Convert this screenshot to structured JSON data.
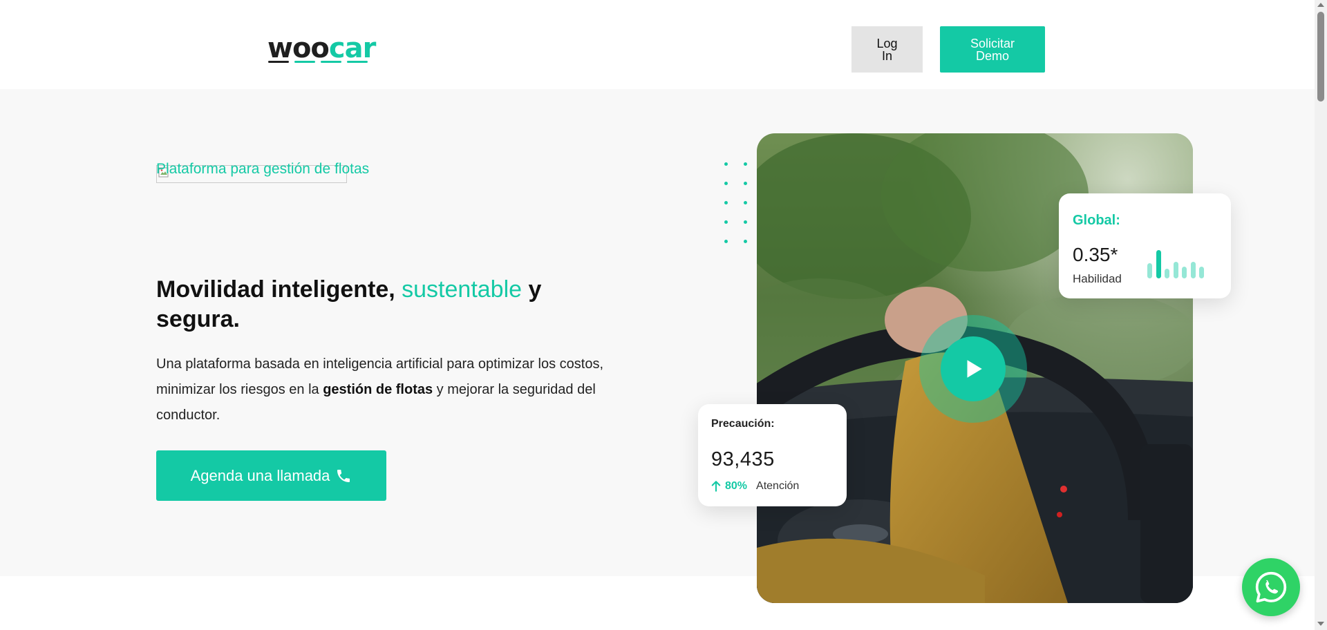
{
  "header": {
    "logo_part1": "woo",
    "logo_part2": "car",
    "login_label": "Log In",
    "demo_label": "Solicitar Demo"
  },
  "hero": {
    "eyebrow": "Plataforma para gestión de flotas",
    "headline_part1": "Movilidad inteligente, ",
    "headline_accent": "sustentable",
    "headline_part2": " y segura.",
    "desc_part1": "Una plataforma basada en inteligencia artificial para optimizar los costos, minimizar los riesgos en la ",
    "desc_bold": "gestión de flotas",
    "desc_part2": " y mejorar la seguridad del conductor.",
    "cta_label": "Agenda una llamada",
    "cta_icon": "phone-icon"
  },
  "card_global": {
    "title": "Global:",
    "value": "0.35*",
    "label": "Habilidad",
    "bar_levels": [
      0.45,
      0.85,
      0.3,
      0.5,
      0.35,
      0.5,
      0.35
    ]
  },
  "card_precaucion": {
    "title": "Precaución:",
    "value": "93,435",
    "trend_pct": "80%",
    "trend_label": "Atención",
    "trend_icon": "arrow-up-icon"
  },
  "media": {
    "play_icon": "play-icon",
    "photo_subject": "driver-steering-wheel-photo"
  },
  "floating": {
    "whatsapp_icon": "whatsapp-icon"
  },
  "colors": {
    "accent": "#14c9a5",
    "whatsapp": "#2fd366",
    "login_bg": "#e4e4e4",
    "hero_bg": "#f8f8f8"
  }
}
